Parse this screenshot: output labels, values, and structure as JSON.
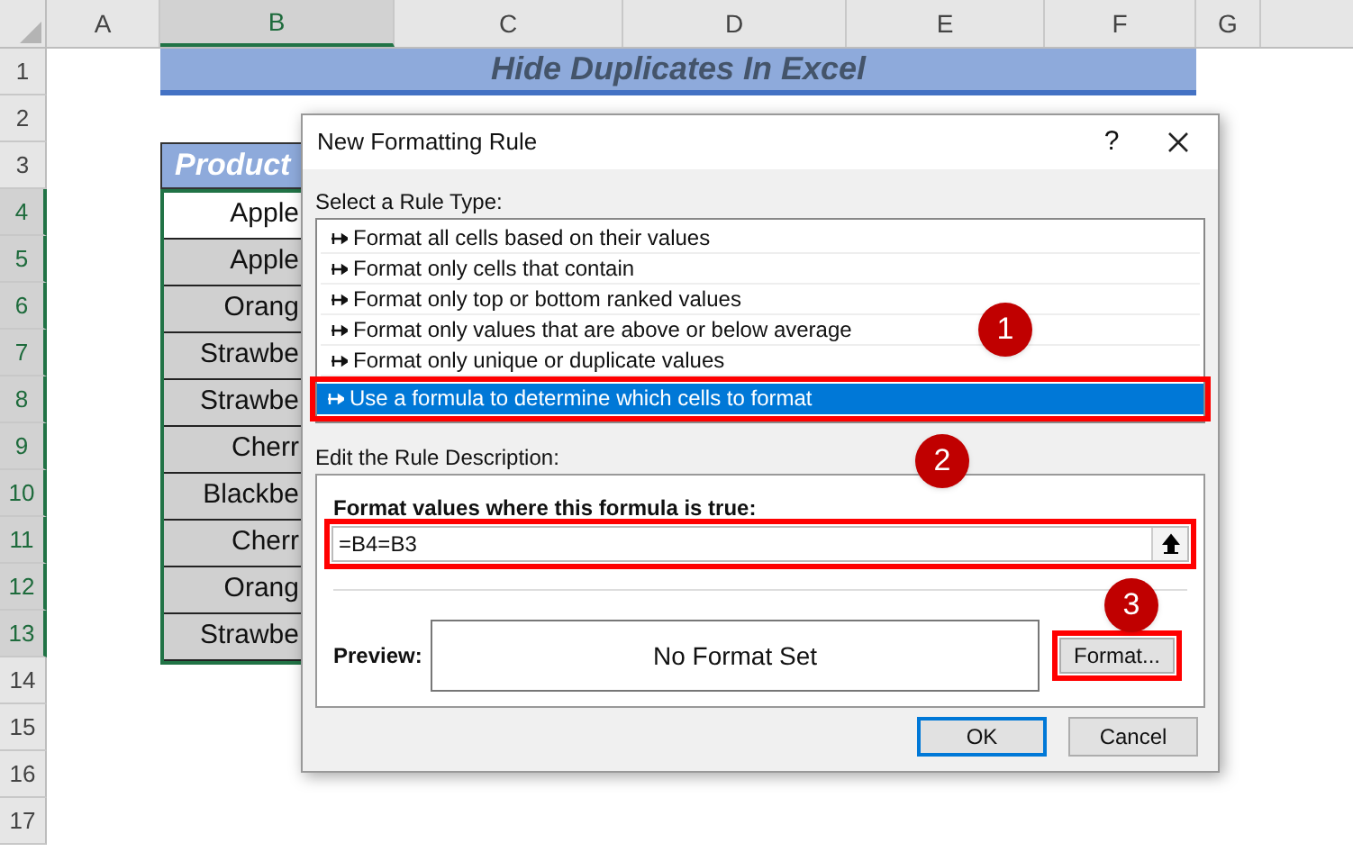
{
  "sheet": {
    "columns": [
      {
        "label": "A",
        "selected": false
      },
      {
        "label": "B",
        "selected": true
      },
      {
        "label": "C",
        "selected": false
      },
      {
        "label": "D",
        "selected": false
      },
      {
        "label": "E",
        "selected": false
      },
      {
        "label": "F",
        "selected": false
      },
      {
        "label": "G",
        "selected": false
      }
    ],
    "rows": [
      {
        "label": "1",
        "selected": false
      },
      {
        "label": "2",
        "selected": false
      },
      {
        "label": "3",
        "selected": false
      },
      {
        "label": "4",
        "selected": true
      },
      {
        "label": "5",
        "selected": true
      },
      {
        "label": "6",
        "selected": true
      },
      {
        "label": "7",
        "selected": true
      },
      {
        "label": "8",
        "selected": true
      },
      {
        "label": "9",
        "selected": true
      },
      {
        "label": "10",
        "selected": true
      },
      {
        "label": "11",
        "selected": true
      },
      {
        "label": "12",
        "selected": true
      },
      {
        "label": "13",
        "selected": true
      },
      {
        "label": "14",
        "selected": false
      },
      {
        "label": "15",
        "selected": false
      },
      {
        "label": "16",
        "selected": false
      },
      {
        "label": "17",
        "selected": false
      }
    ],
    "title": "Hide Duplicates In Excel",
    "header": "Product",
    "cells": [
      {
        "text": "Apple",
        "active": true
      },
      {
        "text": "Apple",
        "active": false
      },
      {
        "text": "Orang",
        "active": false
      },
      {
        "text": "Strawbe",
        "active": false
      },
      {
        "text": "Strawbe",
        "active": false
      },
      {
        "text": "Cherr",
        "active": false
      },
      {
        "text": "Blackbe",
        "active": false
      },
      {
        "text": "Cherr",
        "active": false
      },
      {
        "text": "Orang",
        "active": false
      },
      {
        "text": "Strawbe",
        "active": false
      }
    ]
  },
  "dialog": {
    "title": "New Formatting Rule",
    "help": "?",
    "rule_type_label": "Select a Rule Type:",
    "rule_types": [
      {
        "text": "Format all cells based on their values",
        "selected": false
      },
      {
        "text": "Format only cells that contain",
        "selected": false
      },
      {
        "text": "Format only top or bottom ranked values",
        "selected": false
      },
      {
        "text": "Format only values that are above or below average",
        "selected": false
      },
      {
        "text": "Format only unique or duplicate values",
        "selected": false
      },
      {
        "text": "Use a formula to determine which cells to format",
        "selected": true
      }
    ],
    "description_label": "Edit the Rule Description:",
    "formula_label": "Format values where this formula is true:",
    "formula_value": "=B4=B3",
    "preview_label": "Preview:",
    "preview_text": "No Format Set",
    "format_button": "Format...",
    "ok_button": "OK",
    "cancel_button": "Cancel",
    "callouts": [
      "1",
      "2",
      "3"
    ]
  }
}
